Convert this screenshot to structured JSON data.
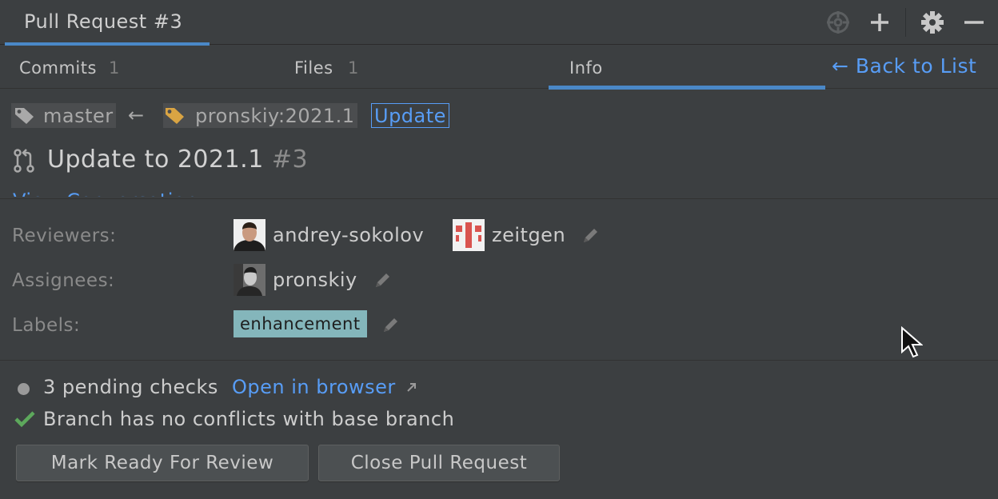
{
  "window": {
    "title": "Pull Request #3"
  },
  "toolbar_icons": [
    "crosshair-icon",
    "plus-icon",
    "gear-icon",
    "minus-icon"
  ],
  "tabs": [
    {
      "label": "Commits",
      "count": "1"
    },
    {
      "label": "Files",
      "count": "1"
    },
    {
      "label": "Info",
      "count": ""
    }
  ],
  "back_link": "← Back to List",
  "branches": {
    "base": "master",
    "arrow": "←",
    "head": "pronskiy:2021.1",
    "update_label": "Update"
  },
  "pr": {
    "title": "Update to 2021.1",
    "number": "#3",
    "clipped_link": "View Conversation"
  },
  "meta": {
    "reviewers_label": "Reviewers:",
    "reviewers": [
      "andrey-sokolov",
      "zeitgen"
    ],
    "assignees_label": "Assignees:",
    "assignees": [
      "pronskiy"
    ],
    "labels_label": "Labels:",
    "labels": [
      "enhancement"
    ]
  },
  "status": {
    "pending": "3 pending checks",
    "open_in_browser": "Open in browser",
    "conflicts": "Branch has no conflicts with base branch"
  },
  "buttons": {
    "mark_ready": "Mark Ready For Review",
    "close": "Close Pull Request"
  },
  "colors": {
    "accent": "#4a88c7",
    "link": "#589df6",
    "label_chip": "#84b6bb",
    "success": "#5da85c",
    "tag_head": "#d9a443"
  }
}
